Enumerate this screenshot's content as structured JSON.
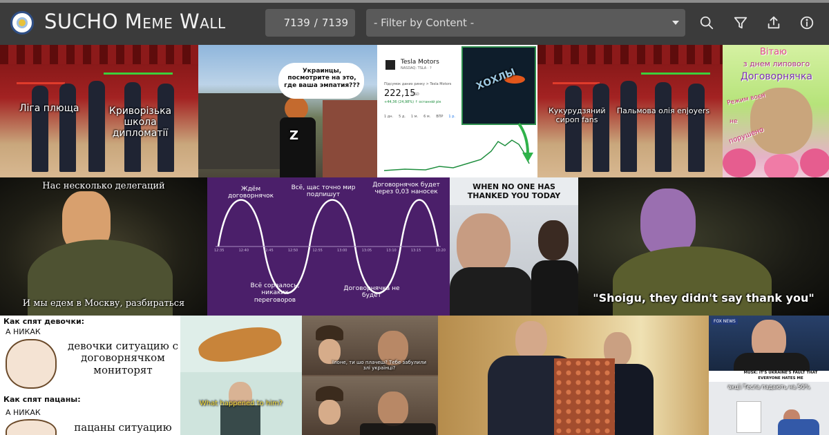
{
  "header": {
    "title": "SUCHO Meme Wall",
    "counter": {
      "current": "7139",
      "separator": "/",
      "total": "7139"
    },
    "filter": {
      "selected": "- Filter by Content -"
    },
    "icons": [
      "search-icon",
      "filter-icon",
      "share-icon",
      "info-icon"
    ]
  },
  "tiles": {
    "t1": {
      "left": "Ліга плюща",
      "right": "Криворізька школа дипломатії"
    },
    "t2": {
      "bubble": "Украинцы, посмотрите на это, где ваша эмпатия???",
      "shirt": "Z"
    },
    "t3": {
      "company": "Tesla Motors",
      "ticker": "NASDAQ: TSLA · ?",
      "label": "Підсумок даних ринку > Tesla Motors",
      "price": "222,15",
      "currency": "USD",
      "change": "+44,36 (24,98%) ↑ останній рік",
      "ranges": [
        "1 дн.",
        "5 д.",
        "1 м.",
        "6 м.",
        "ВПР",
        "1 р."
      ],
      "overlay": "ХОХЛЫ"
    },
    "t4": {
      "left": "Кукурудзяний сироп fans",
      "right": "Пальмова олія enjoyers"
    },
    "t5": {
      "line1": "Вітаю",
      "line2": "з днем липового",
      "line3": "Договорнячка",
      "line4": "Режим воєн",
      "line5": "не",
      "line6": "порушено"
    },
    "t6": {
      "top": "Нас несколько делегаций",
      "bottom": "И мы едем в Москву, разбираться"
    },
    "t7": {
      "peak1": "Ждём договорнячок",
      "peak2": "Всё, щас точно мир подпишут",
      "peak3": "Договорнячок будет через 0,03 наносек",
      "trough1": "Всё сорвалось, никаких переговоров",
      "trough2": "Договорнячка не будет",
      "ticks": [
        "12:35",
        "12:40",
        "12:45",
        "12:50",
        "12:55",
        "13:00",
        "13:05",
        "13:10",
        "13:15",
        "13:20"
      ]
    },
    "t8": {
      "caption": "WHEN NO ONE HAS THANKED YOU TODAY"
    },
    "t9": {
      "caption": "\"Shoigu, they didn't say thank you\""
    },
    "t10": {
      "q1": "Как спят девочки:",
      "a1": "А НИКАК",
      "s1": "девочки ситуацию с договорнячком мониторят",
      "q2": "Как спят пацаны:",
      "a2": "А НИКАК",
      "s2": "пацаны ситуацию"
    },
    "t11": {
      "caption": "What happened to him?"
    },
    "t12": {
      "sub": "Ілоне, ти шо плачеш? Тебе забулили злі українці?"
    },
    "t14": {
      "channel": "FOX NEWS",
      "chyron1": "MUSK: IT'S UKRAINE'S FAULT THAT",
      "chyron2": "EVERYONE HATES ME",
      "caption": "акції Тесла падають на 50%"
    }
  }
}
